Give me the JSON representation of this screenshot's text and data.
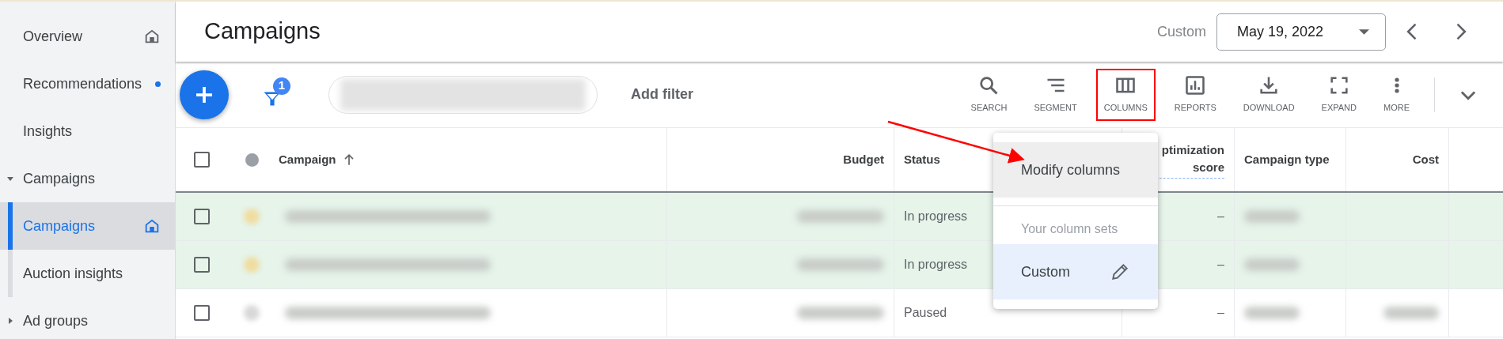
{
  "sidebar": {
    "items": [
      {
        "label": "Overview",
        "kind": "item",
        "selected": false,
        "shortcut": true,
        "notification": false
      },
      {
        "label": "Recommendations",
        "kind": "item",
        "selected": false,
        "shortcut": false,
        "notification": true
      },
      {
        "label": "Insights",
        "kind": "item",
        "selected": false,
        "shortcut": false,
        "notification": false
      },
      {
        "label": "Campaigns",
        "kind": "section",
        "expanded": true,
        "children": [
          {
            "label": "Campaigns",
            "kind": "item",
            "selected": true,
            "shortcut": true,
            "notification": false
          },
          {
            "label": "Auction insights",
            "kind": "item",
            "selected": false,
            "shortcut": false,
            "notification": false
          }
        ]
      },
      {
        "label": "Ad groups",
        "kind": "section",
        "expanded": false
      }
    ]
  },
  "header": {
    "title": "Campaigns",
    "range_label": "Custom",
    "date": "May 19, 2022"
  },
  "toolbar": {
    "filter_count": "1",
    "add_filter": "Add filter",
    "tools": [
      {
        "kind": "search",
        "label": "SEARCH",
        "highlighted": false
      },
      {
        "kind": "segment",
        "label": "SEGMENT",
        "highlighted": false
      },
      {
        "kind": "columns",
        "label": "COLUMNS",
        "highlighted": true
      },
      {
        "kind": "reports",
        "label": "REPORTS",
        "highlighted": false
      },
      {
        "kind": "download",
        "label": "DOWNLOAD",
        "highlighted": false
      },
      {
        "kind": "expand",
        "label": "EXPAND",
        "highlighted": false
      },
      {
        "kind": "more",
        "label": "MORE",
        "highlighted": false
      }
    ]
  },
  "table": {
    "all_checked": false,
    "columns": [
      {
        "label": "Campaign",
        "sorted": true
      },
      {
        "label": "Budget",
        "sorted": false
      },
      {
        "label": "Status",
        "sorted": false
      },
      {
        "label": "ptimization score",
        "sorted": false
      },
      {
        "label": "Campaign type",
        "sorted": false
      },
      {
        "label": "Cost",
        "sorted": false
      }
    ],
    "rows": [
      {
        "checked": false,
        "highlighted": true,
        "status": "In progress",
        "optimization_score": "–"
      },
      {
        "checked": false,
        "highlighted": true,
        "status": "In progress",
        "optimization_score": "–"
      },
      {
        "checked": false,
        "highlighted": false,
        "status": "Paused",
        "optimization_score": "–"
      }
    ]
  },
  "columns_menu": {
    "items": [
      {
        "kind": "action",
        "label": "Modify columns",
        "hovered": true
      },
      {
        "kind": "heading",
        "label": "Your column sets"
      },
      {
        "kind": "set",
        "label": "Custom",
        "selected": true
      }
    ]
  }
}
